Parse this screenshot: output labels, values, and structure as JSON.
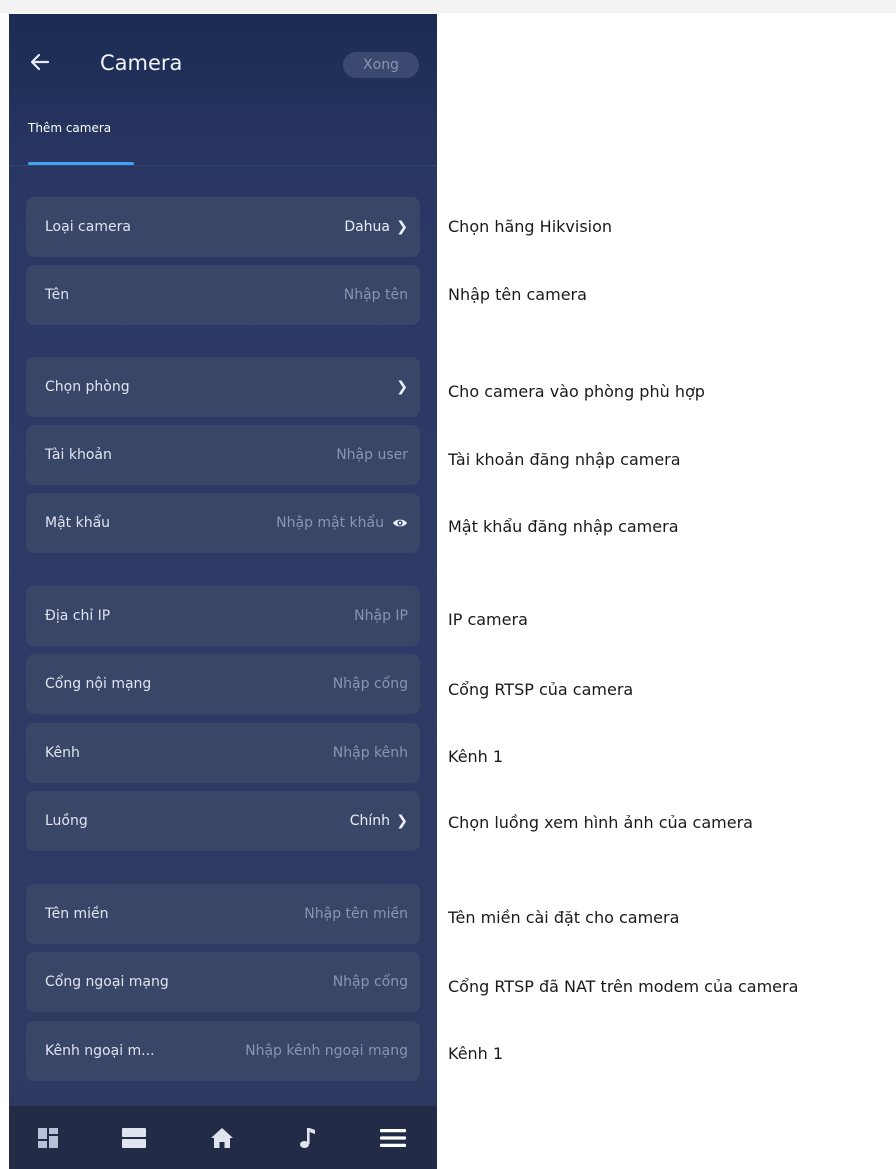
{
  "header": {
    "title": "Camera",
    "done_label": "Xong",
    "tab": "Thêm camera"
  },
  "rows": [
    {
      "label": "Loại camera",
      "value": "Dahua"
    },
    {
      "label": "Tên",
      "placeholder": "Nhập tên"
    },
    {
      "label": "Chọn phòng"
    },
    {
      "label": "Tài khoản",
      "placeholder": "Nhập user"
    },
    {
      "label": "Mật khẩu",
      "placeholder": "Nhập mật khẩu"
    },
    {
      "label": "Địa chỉ IP",
      "placeholder": "Nhập IP"
    },
    {
      "label": "Cổng nội mạng",
      "placeholder": "Nhập cổng"
    },
    {
      "label": "Kênh",
      "placeholder": "Nhập kênh"
    },
    {
      "label": "Luồng",
      "value": "Chính"
    },
    {
      "label": "Tên miền",
      "placeholder": "Nhập tên miền"
    },
    {
      "label": "Cổng ngoại mạng",
      "placeholder": "Nhập cổng"
    },
    {
      "label": "Kênh ngoại m...",
      "placeholder": "Nhập kênh ngoại mạng"
    }
  ],
  "notes": [
    "Chọn hãng Hikvision",
    "Nhập tên camera",
    "Cho camera vào phòng phù hợp",
    "Tài khoản đăng nhập camera",
    "Mật khẩu đăng nhập camera",
    "IP camera",
    "Cổng RTSP của camera",
    "Kênh 1",
    "Chọn luồng xem hình ảnh của camera",
    "Tên miền cài đặt cho camera",
    "Cổng RTSP đã NAT trên modem của camera",
    "Kênh 1"
  ],
  "icons": {
    "back": "arrow-left-icon",
    "chevron": "chevron-right-icon",
    "eye": "eye-icon",
    "nav": [
      "dashboard-icon",
      "list-icon",
      "home-icon",
      "music-icon",
      "menu-icon"
    ]
  },
  "colors": {
    "accent": "#3fa2f4",
    "background": "#2d395f",
    "row": "#3a4667"
  }
}
